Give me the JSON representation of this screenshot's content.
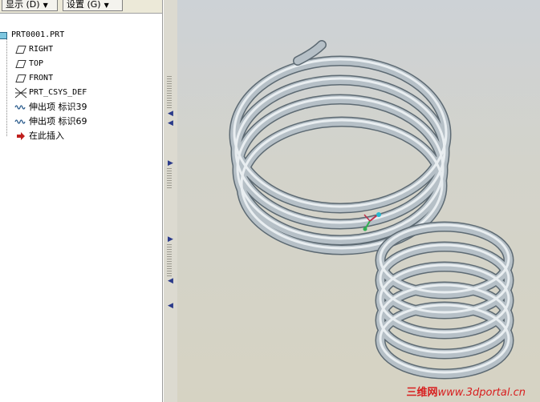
{
  "toolbar": {
    "show_label": "显示 (D)",
    "settings_label": "设置 (G)"
  },
  "tree": {
    "items": [
      {
        "label": "PRT0001.PRT",
        "icon": "part-icon"
      },
      {
        "label": "RIGHT",
        "icon": "datum-plane-icon"
      },
      {
        "label": "TOP",
        "icon": "datum-plane-icon"
      },
      {
        "label": "FRONT",
        "icon": "datum-plane-icon"
      },
      {
        "label": "PRT_CSYS_DEF",
        "icon": "coordinate-system-icon"
      },
      {
        "label": "伸出项 标识39",
        "icon": "sweep-feature-icon"
      },
      {
        "label": "伸出项 标识69",
        "icon": "sweep-feature-icon"
      },
      {
        "label": "在此插入",
        "icon": "insert-here-arrow-icon"
      }
    ]
  },
  "viewport": {
    "background_top": "#cdd2d6",
    "background_bottom": "#d6d3c3",
    "coil_color": "#a9b3ba",
    "coil_outline": "#5d6a73"
  },
  "watermark": {
    "brand": "三维网",
    "site": "www.3dportal.cn"
  }
}
